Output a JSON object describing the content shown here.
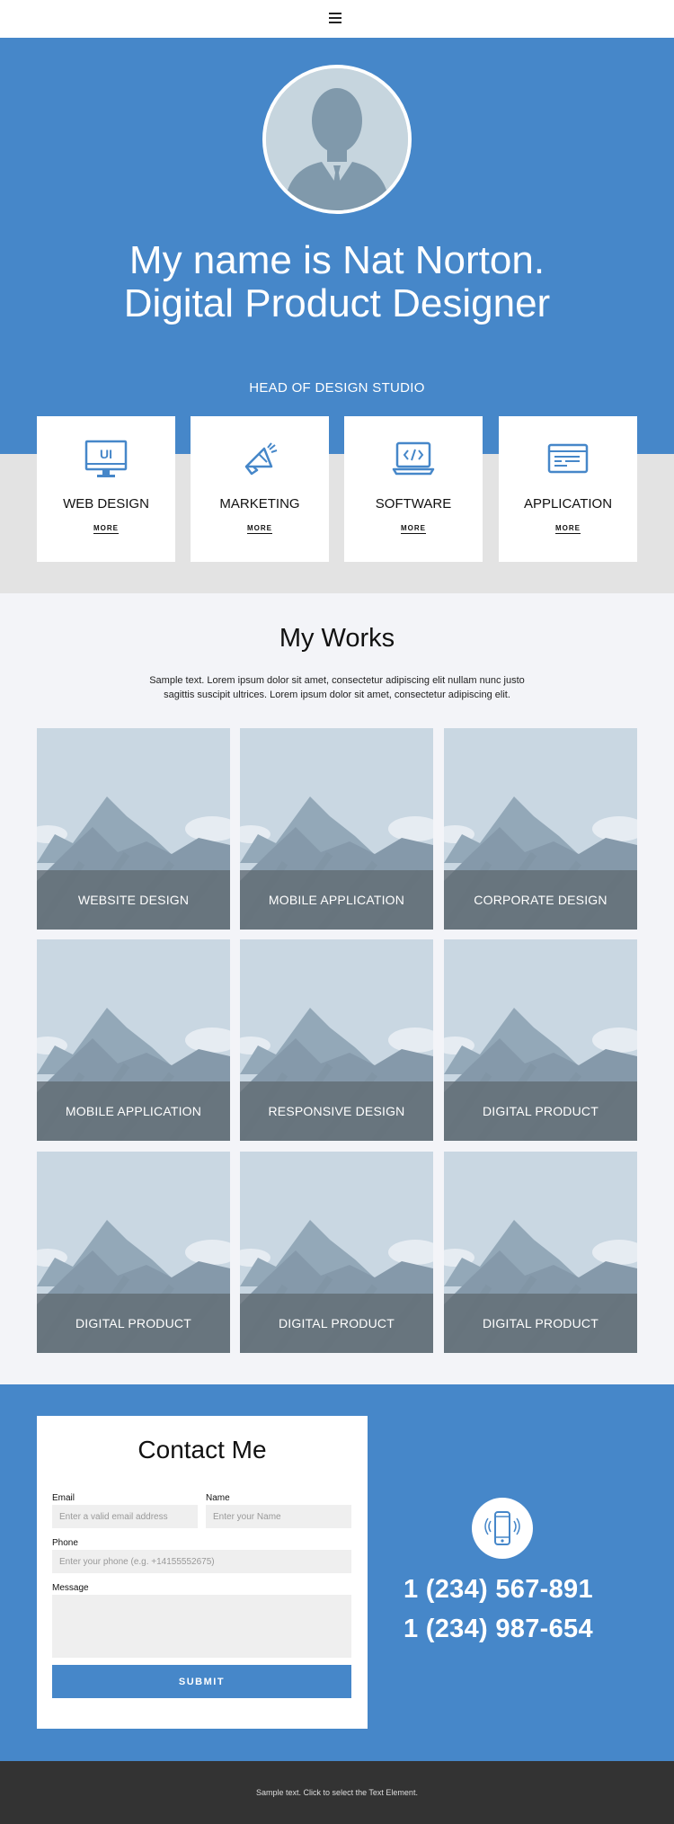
{
  "header": {
    "menu_icon": "hamburger-menu-icon"
  },
  "hero": {
    "avatar_icon": "person-avatar-icon",
    "title_line1": "My name is Nat Norton.",
    "title_line2": "Digital Product Designer",
    "subtitle": "HEAD OF DESIGN STUDIO",
    "background": "#4687c9"
  },
  "services": [
    {
      "title": "WEB DESIGN",
      "more": "MORE",
      "icon": "monitor-ui-icon"
    },
    {
      "title": "MARKETING",
      "more": "MORE",
      "icon": "megaphone-icon"
    },
    {
      "title": "SOFTWARE",
      "more": "MORE",
      "icon": "laptop-code-icon"
    },
    {
      "title": "APPLICATION",
      "more": "MORE",
      "icon": "browser-window-icon"
    }
  ],
  "works": {
    "title": "My Works",
    "text": "Sample text. Lorem ipsum dolor sit amet, consectetur adipiscing elit nullam nunc justo sagittis suscipit ultrices. Lorem ipsum dolor sit amet, consectetur adipiscing elit.",
    "items": [
      {
        "label": "WEBSITE DESIGN"
      },
      {
        "label": "MOBILE APPLICATION"
      },
      {
        "label": "CORPORATE DESIGN"
      },
      {
        "label": "MOBILE APPLICATION"
      },
      {
        "label": "RESPONSIVE DESIGN"
      },
      {
        "label": "DIGITAL PRODUCT"
      },
      {
        "label": "DIGITAL PRODUCT"
      },
      {
        "label": "DIGITAL PRODUCT"
      },
      {
        "label": "DIGITAL PRODUCT"
      }
    ]
  },
  "contact": {
    "title": "Contact Me",
    "email_label": "Email",
    "email_placeholder": "Enter a valid email address",
    "name_label": "Name",
    "name_placeholder": "Enter your Name",
    "phone_label": "Phone",
    "phone_placeholder": "Enter your phone (e.g. +14155552675)",
    "message_label": "Message",
    "message_placeholder": "",
    "submit_label": "SUBMIT",
    "phone_icon": "smartphone-ringing-icon",
    "phone1": "1 (234) 567-891",
    "phone2": "1 (234) 987-654"
  },
  "footer": {
    "text": "Sample text. Click to select the Text Element."
  },
  "colors": {
    "accent": "#4687c9",
    "works_bg": "#f3f4f8",
    "services_bg": "#e3e3e3",
    "footer_bg": "#333333"
  }
}
